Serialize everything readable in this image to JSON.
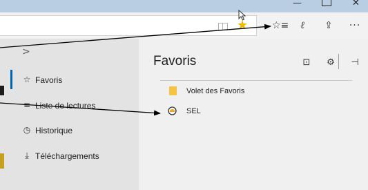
{
  "window": {
    "minimize_glyph": "—",
    "close_glyph": "✕"
  },
  "toolbar": {
    "reading_view_icon": "reading-view-icon",
    "addfav_icon": "star-icon",
    "addfav_glyph": "★",
    "addfav_color": "#f5b400",
    "hub_glyph": "☆≡",
    "notes_glyph": "ℓ",
    "share_glyph": "⇪",
    "more_glyph": "···"
  },
  "hub": {
    "collapse_glyph": ">",
    "accent_color": "#0063b1",
    "nav_items": [
      {
        "icon": "star-list-icon",
        "glyph": "☆",
        "label": "Favoris"
      },
      {
        "icon": "reading-list-icon",
        "glyph": "≡",
        "label": "Liste de lectures"
      },
      {
        "icon": "history-icon",
        "glyph": "◷",
        "label": "Historique"
      },
      {
        "icon": "download-icon",
        "glyph": "⤓",
        "label": "Téléchargements"
      }
    ],
    "favorites": {
      "title": "Favoris",
      "import_glyph": "⊡",
      "settings_glyph": "⚙",
      "pin_glyph": "⊣",
      "items": [
        {
          "icon": "folder-icon",
          "label": "Volet des Favoris"
        },
        {
          "icon": "site-favicon-icon",
          "label": "SEL"
        }
      ]
    }
  }
}
